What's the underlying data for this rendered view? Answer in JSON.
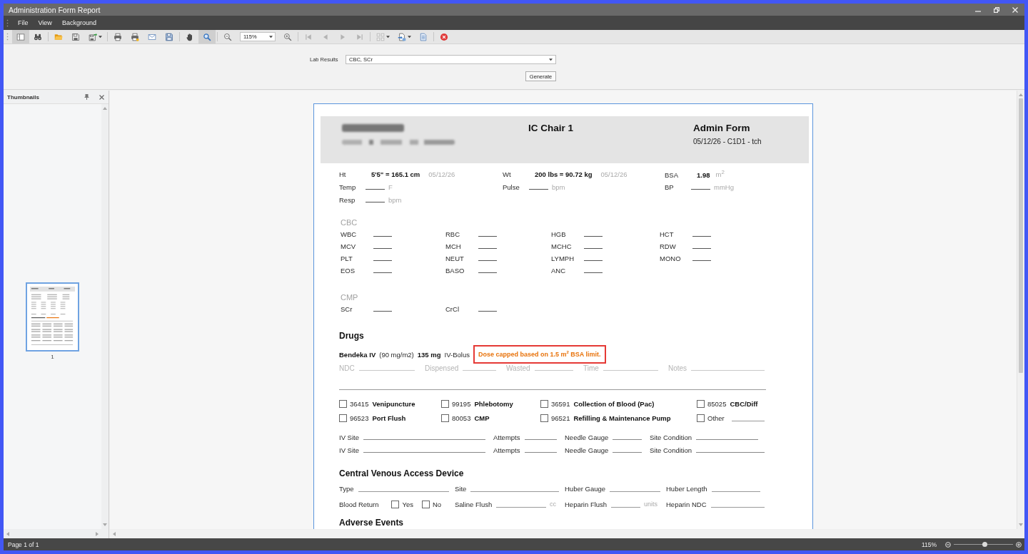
{
  "window": {
    "title": "Administration Form Report"
  },
  "menu": [
    {
      "label": "File"
    },
    {
      "label": "View"
    },
    {
      "label": "Background"
    }
  ],
  "toolbar": {
    "groups": [
      [
        {
          "kind": "button",
          "pressed": true,
          "disabled": false
        },
        {
          "kind": "button",
          "pressed": false,
          "disabled": false
        }
      ],
      [
        {
          "kind": "button",
          "pressed": false,
          "disabled": false
        },
        {
          "kind": "button",
          "pressed": false,
          "disabled": false
        },
        {
          "kind": "split",
          "pressed": false,
          "disabled": false
        }
      ],
      [
        {
          "kind": "button",
          "pressed": false,
          "disabled": false
        },
        {
          "kind": "button",
          "pressed": false,
          "disabled": false
        },
        {
          "kind": "button",
          "pressed": false,
          "disabled": false
        },
        {
          "kind": "button",
          "pressed": false,
          "disabled": false
        }
      ],
      [
        {
          "kind": "button",
          "pressed": false,
          "disabled": false
        },
        {
          "kind": "button",
          "pressed": true,
          "disabled": false
        }
      ],
      [
        {
          "kind": "button",
          "pressed": false,
          "disabled": false
        },
        {
          "kind": "combo",
          "value": "115%",
          "pressed": false,
          "disabled": false
        },
        {
          "kind": "button",
          "pressed": false,
          "disabled": false
        }
      ],
      [
        {
          "kind": "button",
          "pressed": false,
          "disabled": true
        },
        {
          "kind": "button",
          "pressed": false,
          "disabled": true
        },
        {
          "kind": "button",
          "pressed": false,
          "disabled": true
        },
        {
          "kind": "button",
          "pressed": false,
          "disabled": true
        }
      ],
      [
        {
          "kind": "split",
          "pressed": false,
          "disabled": true
        },
        {
          "kind": "split",
          "pressed": false,
          "disabled": false
        },
        {
          "kind": "button",
          "pressed": false,
          "disabled": false
        }
      ],
      [
        {
          "kind": "button",
          "pressed": false,
          "disabled": false
        }
      ]
    ]
  },
  "parameters": {
    "fields": [
      {
        "label": "Lab Results",
        "value": "CBC, SCr"
      }
    ],
    "submit": "Generate"
  },
  "thumbnails_panel": {
    "title": "Thumbnails",
    "pages": [
      {
        "label": "1",
        "selected": true
      }
    ]
  },
  "report": {
    "header": {
      "location": "IC Chair 1",
      "title": "Admin Form",
      "subtitle": "05/12/26 - C1D1 - tch"
    },
    "vitals": [
      {
        "kind": "reading",
        "label": "Ht",
        "value": "5'5\" = 165.1 cm",
        "date": "05/12/26"
      },
      {
        "kind": "reading",
        "label": "Wt",
        "value": "200 lbs = 90.72 kg",
        "date": "05/12/26"
      },
      {
        "kind": "reading",
        "label": "BSA",
        "value": "1.98",
        "unit": "m$^{2}$"
      },
      {
        "kind": "blank",
        "label": "Temp",
        "unit": "F"
      },
      {
        "kind": "blank",
        "label": "Pulse",
        "unit": "bpm"
      },
      {
        "kind": "blank",
        "label": "BP",
        "unit": "mmHg"
      },
      {
        "kind": "blank",
        "label": "Resp",
        "unit": "bpm"
      }
    ],
    "lab_panels": [
      {
        "title": "CBC",
        "tests": [
          "WBC",
          "RBC",
          "HGB",
          "HCT",
          "MCV",
          "MCH",
          "MCHC",
          "RDW",
          "PLT",
          "NEUT",
          "LYMPH",
          "MONO",
          "EOS",
          "BASO",
          "ANC"
        ]
      },
      {
        "title": "CMP",
        "tests": [
          "SCr",
          "CrCl"
        ]
      }
    ],
    "drugs": {
      "title": "Drugs",
      "items": [
        {
          "name": "Bendeka IV",
          "dosing": "(90 mg/m2)",
          "dose": "135 mg",
          "route": "IV-Bolus",
          "alert": "Dose capped based on 1.5 m$^{2}$ BSA limit.",
          "fields": [
            "NDC",
            "Dispensed",
            "Wasted",
            "Time",
            "Notes"
          ]
        }
      ]
    },
    "procedures": [
      {
        "kind": "code",
        "code": "36415",
        "name": "Venipuncture",
        "checked": false
      },
      {
        "kind": "code",
        "code": "99195",
        "name": "Phlebotomy",
        "checked": false
      },
      {
        "kind": "code",
        "code": "36591",
        "name": "Collection of Blood (Pac)",
        "checked": false
      },
      {
        "kind": "code",
        "code": "85025",
        "name": "CBC/Diff",
        "checked": false
      },
      {
        "kind": "code",
        "code": "96523",
        "name": "Port Flush",
        "checked": false
      },
      {
        "kind": "code",
        "code": "80053",
        "name": "CMP",
        "checked": false
      },
      {
        "kind": "code",
        "code": "96521",
        "name": "Refilling & Maintenance Pump",
        "checked": false
      },
      {
        "kind": "other",
        "name": "Other",
        "checked": false
      }
    ],
    "iv_sites": [
      {
        "fields": [
          "IV Site",
          "Attempts",
          "Needle Gauge",
          "Site Condition"
        ]
      },
      {
        "fields": [
          "IV Site",
          "Attempts",
          "Needle Gauge",
          "Site Condition"
        ]
      }
    ],
    "cvad": {
      "title": "Central Venous Access Device",
      "fields": [
        {
          "kind": "blank",
          "label": "Type"
        },
        {
          "kind": "blank",
          "label": "Site"
        },
        {
          "kind": "blank",
          "label": "Huber Gauge"
        },
        {
          "kind": "blank",
          "label": "Huber Length"
        },
        {
          "kind": "choice",
          "label": "Blood Return",
          "options": [
            {
              "label": "Yes",
              "checked": false
            },
            {
              "label": "No",
              "checked": false
            }
          ]
        },
        {
          "kind": "blank",
          "label": "Saline Flush",
          "unit": "cc"
        },
        {
          "kind": "blank",
          "label": "Heparin Flush",
          "unit": "units"
        },
        {
          "kind": "blank",
          "label": "Heparin NDC"
        }
      ]
    },
    "next_section": {
      "title": "Adverse Events"
    }
  },
  "status_bar": {
    "page": "Page 1 of 1",
    "zoom": {
      "reading": "115%",
      "level": 0.52
    }
  }
}
